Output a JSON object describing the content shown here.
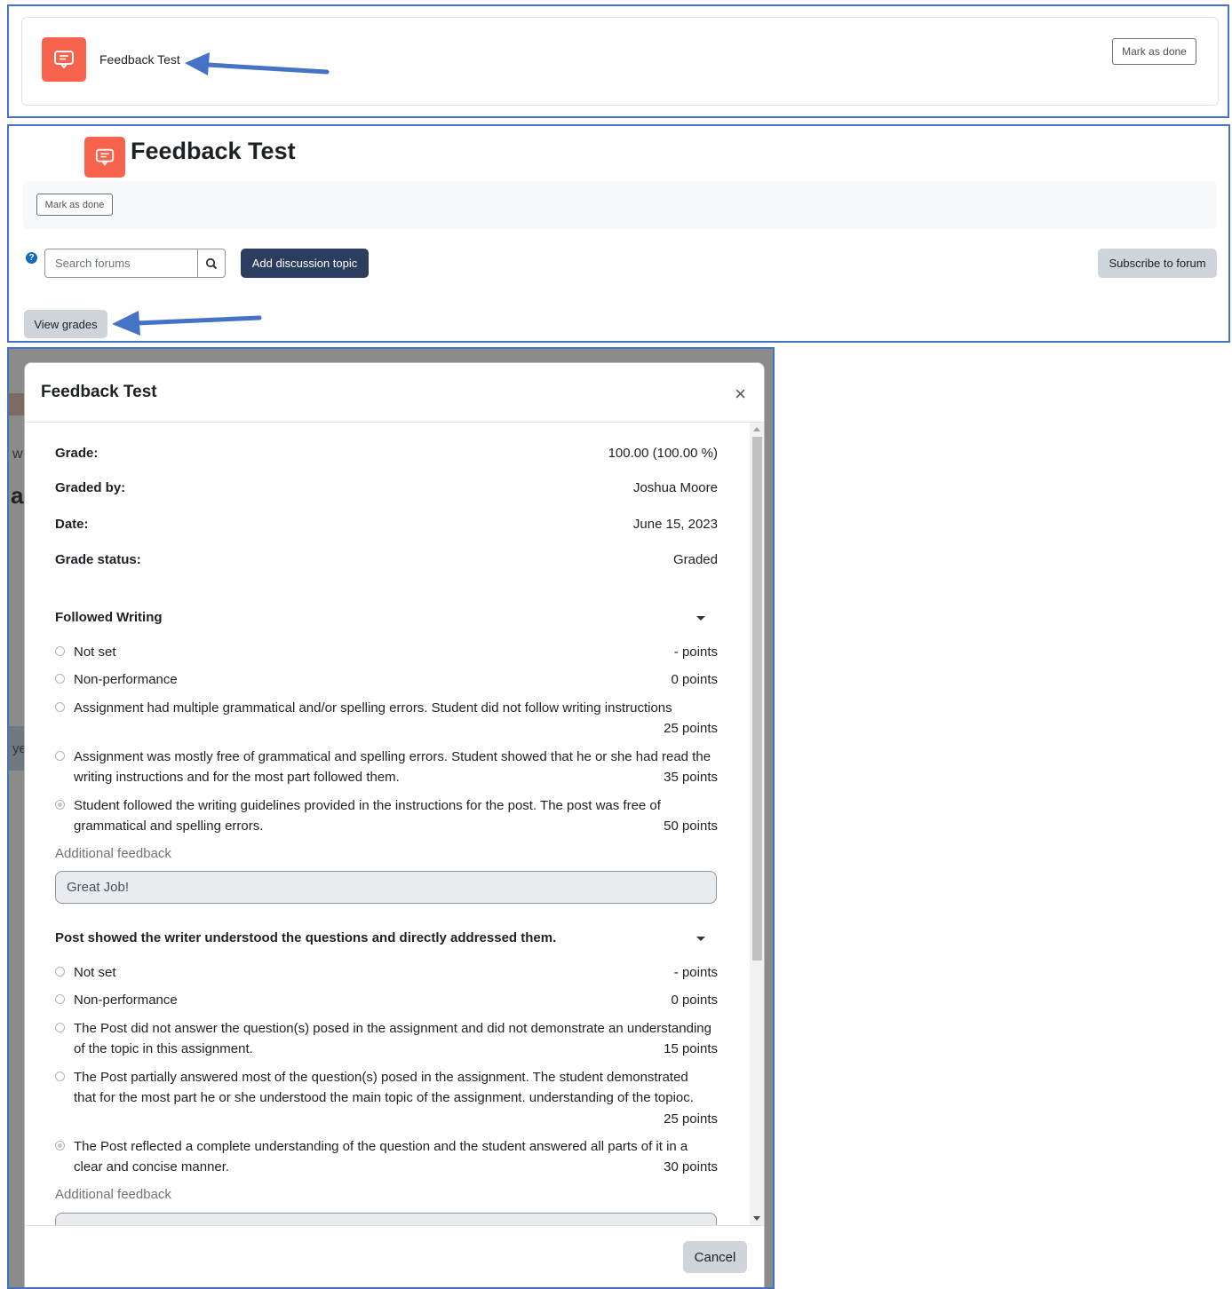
{
  "activity": {
    "title": "Feedback Test",
    "mark_done_label": "Mark as done"
  },
  "forum": {
    "search_placeholder": "Search forums",
    "help_icon": "?",
    "add_topic_label": "Add discussion topic",
    "subscribe_label": "Subscribe to forum",
    "view_grades_label": "View grades"
  },
  "background_fragments": {
    "a": "w",
    "b": "a",
    "c": "ye"
  },
  "modal": {
    "title": "Feedback Test",
    "close_glyph": "×",
    "summary": [
      {
        "label": "Grade:",
        "value": "100.00 (100.00 %)"
      },
      {
        "label": "Graded by:",
        "value": "Joshua Moore"
      },
      {
        "label": "Date:",
        "value": "June 15, 2023"
      },
      {
        "label": "Grade status:",
        "value": "Graded"
      }
    ],
    "criteria": [
      {
        "title": "Followed Writing",
        "levels": [
          {
            "text": "Not set",
            "points": "- points",
            "selected": false
          },
          {
            "text": "Non-performance",
            "points": "0 points",
            "selected": false
          },
          {
            "text": "Assignment had multiple grammatical and/or spelling errors. Student did not follow writing instructions",
            "points": "25 points",
            "selected": false
          },
          {
            "text": "Assignment was mostly free of grammatical and spelling errors. Student showed that he or she had read the writing instructions and for the most part followed them.",
            "points": "35 points",
            "selected": false
          },
          {
            "text": "Student followed the writing guidelines provided in the instructions for the post. The post was free of grammatical and spelling errors.",
            "points": "50 points",
            "selected": true
          }
        ],
        "feedback_label": "Additional feedback",
        "feedback_value": "Great Job!"
      },
      {
        "title": "Post showed the writer understood the questions and directly addressed them.",
        "levels": [
          {
            "text": "Not set",
            "points": "- points",
            "selected": false
          },
          {
            "text": "Non-performance",
            "points": "0 points",
            "selected": false
          },
          {
            "text": "The Post did not answer the question(s) posed in the assignment and did not demonstrate an understanding of the topic in this assignment.",
            "points": "15 points",
            "selected": false
          },
          {
            "text": "The Post partially answered most of the question(s) posed in the assignment. The student demonstrated that for the most part he or she understood the main topic of the assignment. understanding of the topioc.",
            "points": "25 points",
            "selected": false
          },
          {
            "text": "The Post reflected a complete understanding of the question and the student answered all parts of it in a clear and concise manner.",
            "points": "30 points",
            "selected": true
          }
        ],
        "feedback_label": "Additional feedback",
        "feedback_value": ""
      }
    ],
    "cancel_label": "Cancel"
  },
  "colors": {
    "activity_icon": "#f7634d",
    "primary_button": "#2c3e5f",
    "secondary_button": "#ced4da",
    "annotation_arrow": "#4472c4"
  }
}
